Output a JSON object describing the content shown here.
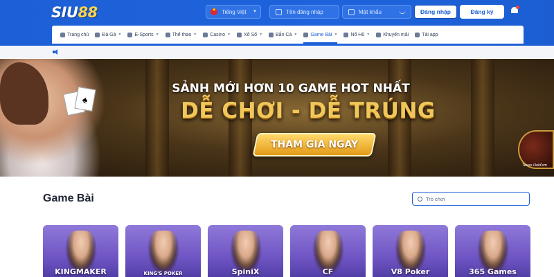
{
  "header": {
    "logo_main": "SIU",
    "logo_accent": "88",
    "language": "Tiếng Việt",
    "username_placeholder": "Tên đăng nhập",
    "password_placeholder": "Mật khẩu",
    "login_label": "Đăng nhập",
    "register_label": "Đăng ký"
  },
  "nav": {
    "items": [
      {
        "label": "Trang chủ",
        "has_caret": false
      },
      {
        "label": "Đá Gà",
        "has_caret": true
      },
      {
        "label": "E-Sports",
        "has_caret": true
      },
      {
        "label": "Thể thao",
        "has_caret": true
      },
      {
        "label": "Casino",
        "has_caret": true
      },
      {
        "label": "Xổ Số",
        "has_caret": true
      },
      {
        "label": "Bắn Cá",
        "has_caret": true
      },
      {
        "label": "Game Bài",
        "has_caret": true
      },
      {
        "label": "Nổ Hũ",
        "has_caret": true
      },
      {
        "label": "Khuyến mãi",
        "has_caret": false
      },
      {
        "label": "Tải app",
        "has_caret": false
      }
    ],
    "active": "Game Bài"
  },
  "banner": {
    "subtitle": "SẢNH MỚI HƠN 10 GAME HOT NHẤT",
    "headline": "DỄ CHƠI - DỄ TRÚNG",
    "cta": "THAM GIA NGAY",
    "badge": "Texas Hold'em"
  },
  "section": {
    "title": "Game Bài",
    "search_placeholder": "Trò chơi"
  },
  "games": [
    {
      "brand": "KINGMAKER"
    },
    {
      "brand": "KING'S POKER"
    },
    {
      "brand": "SpiniX"
    },
    {
      "brand": "CF"
    },
    {
      "brand": "V8 Poker"
    },
    {
      "brand": "365 Games"
    }
  ],
  "colors": {
    "brand_blue": "#1d5fd6",
    "card_purple": "#6e54c3",
    "headline_gold": "#f2c75a"
  }
}
